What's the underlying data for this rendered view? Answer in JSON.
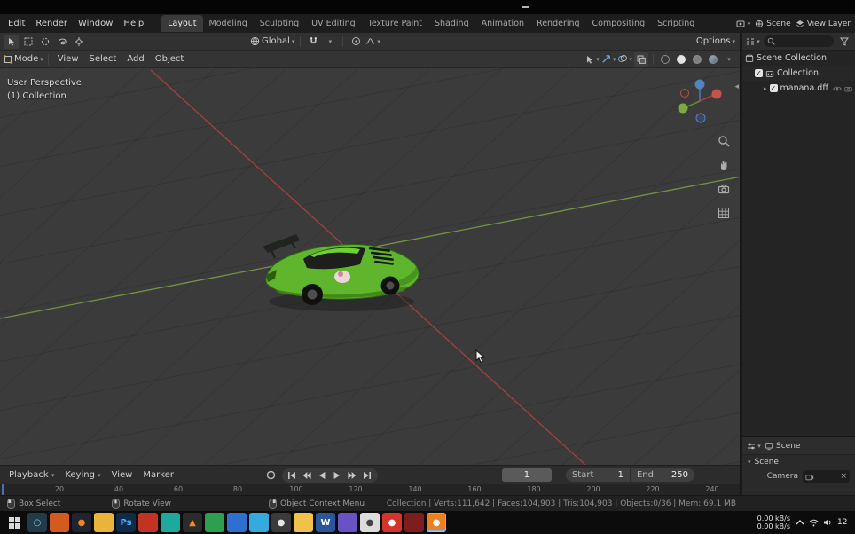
{
  "topbar": {
    "menus": [
      "Edit",
      "Render",
      "Window",
      "Help"
    ],
    "tabs": [
      "Layout",
      "Modeling",
      "Sculpting",
      "UV Editing",
      "Texture Paint",
      "Shading",
      "Animation",
      "Rendering",
      "Compositing",
      "Scripting"
    ],
    "scene_label": "Scene",
    "view_layer_label": "View Layer"
  },
  "tool_header": {
    "orientation_label": "Global",
    "options_label": "Options"
  },
  "viewport_header": {
    "mode_label": "Mode",
    "menus": [
      "View",
      "Select",
      "Add",
      "Object"
    ]
  },
  "viewport": {
    "perspective_label": "User Perspective",
    "collection_label": "(1) Collection"
  },
  "outliner": {
    "rows": [
      {
        "label": "Scene Collection"
      },
      {
        "label": "Collection"
      },
      {
        "label": "manana.dff"
      }
    ]
  },
  "properties": {
    "breadcrumb": "Scene",
    "panel_label": "Scene",
    "camera_label": "Camera"
  },
  "timeline": {
    "menus": [
      "Playback",
      "Keying",
      "View",
      "Marker"
    ],
    "current_frame": "1",
    "start_label": "Start",
    "start_value": "1",
    "end_label": "End",
    "end_value": "250",
    "ticks": [
      20,
      40,
      60,
      80,
      100,
      120,
      140,
      160,
      180,
      200,
      220,
      240
    ]
  },
  "statusbar": {
    "hints": [
      "Box Select",
      "Rotate View",
      "Object Context Menu"
    ],
    "stats": "Collection | Verts:111,642 | Faces:104,903 | Tris:104,903 | Objects:0/36 | Mem: 69.1 MB"
  },
  "taskbar": {
    "net_up": "0.00 kB/s",
    "net_down": "0.00 kB/s",
    "clock": "12",
    "apps": [
      {
        "name": "taskbar-app-search",
        "glyph": "○",
        "color": "#223a4a",
        "fg": "#7fd0f2"
      },
      {
        "name": "taskbar-app-2",
        "glyph": "",
        "color": "#d45b20",
        "fg": "#ffffff"
      },
      {
        "name": "taskbar-app-firefox",
        "glyph": "●",
        "color": "#20242e",
        "fg": "#f2822a"
      },
      {
        "name": "taskbar-app-folder",
        "glyph": "",
        "color": "#e8b53a",
        "fg": "#ffffff"
      },
      {
        "name": "taskbar-app-photoshop",
        "glyph": "Ps",
        "color": "#0e2b4c",
        "fg": "#53b2f0"
      },
      {
        "name": "taskbar-app-6",
        "glyph": "",
        "color": "#c23324",
        "fg": "#ffffff"
      },
      {
        "name": "taskbar-app-7",
        "glyph": "",
        "color": "#1fa99c",
        "fg": "#ffffff"
      },
      {
        "name": "taskbar-app-vlc",
        "glyph": "▲",
        "color": "#2b2b2b",
        "fg": "#f08c1e"
      },
      {
        "name": "taskbar-app-9",
        "glyph": "",
        "color": "#2e9e4f",
        "fg": "#ffffff"
      },
      {
        "name": "taskbar-app-10",
        "glyph": "",
        "color": "#2f6fd0",
        "fg": "#ffffff"
      },
      {
        "name": "taskbar-app-11",
        "glyph": "",
        "color": "#35aade",
        "fg": "#ffffff"
      },
      {
        "name": "taskbar-app-12",
        "glyph": "●",
        "color": "#3b3b3b",
        "fg": "#e5e5e5"
      },
      {
        "name": "taskbar-app-13",
        "glyph": "",
        "color": "#f0c14b",
        "fg": "#ffffff"
      },
      {
        "name": "taskbar-app-word",
        "glyph": "W",
        "color": "#2b579a",
        "fg": "#ffffff"
      },
      {
        "name": "taskbar-app-15",
        "glyph": "",
        "color": "#6a52c4",
        "fg": "#ffffff"
      },
      {
        "name": "taskbar-app-16",
        "glyph": "●",
        "color": "#dcdcdc",
        "fg": "#444444"
      },
      {
        "name": "taskbar-app-17",
        "glyph": "●",
        "color": "#d3342b",
        "fg": "#ffffff"
      },
      {
        "name": "taskbar-app-18",
        "glyph": "",
        "color": "#7e1d1d",
        "fg": "#ffffff"
      },
      {
        "name": "taskbar-app-blender",
        "glyph": "●",
        "color": "#ec7f1f",
        "fg": "#ffffff",
        "active": true
      }
    ]
  },
  "colors": {
    "accent_blue": "#4772b3",
    "axis_x_red": "#b4443e",
    "axis_y_green": "#7ea342",
    "car_green": "#5fb52b"
  }
}
